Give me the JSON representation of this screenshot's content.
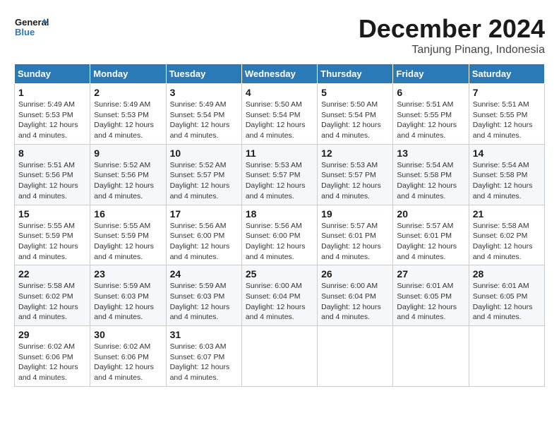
{
  "header": {
    "logo_line1": "General",
    "logo_line2": "Blue",
    "month_title": "December 2024",
    "location": "Tanjung Pinang, Indonesia"
  },
  "days_of_week": [
    "Sunday",
    "Monday",
    "Tuesday",
    "Wednesday",
    "Thursday",
    "Friday",
    "Saturday"
  ],
  "weeks": [
    [
      {
        "day": 1,
        "sunrise": "5:49 AM",
        "sunset": "5:53 PM",
        "daylight": "12 hours and 4 minutes"
      },
      {
        "day": 2,
        "sunrise": "5:49 AM",
        "sunset": "5:53 PM",
        "daylight": "12 hours and 4 minutes"
      },
      {
        "day": 3,
        "sunrise": "5:49 AM",
        "sunset": "5:54 PM",
        "daylight": "12 hours and 4 minutes"
      },
      {
        "day": 4,
        "sunrise": "5:50 AM",
        "sunset": "5:54 PM",
        "daylight": "12 hours and 4 minutes"
      },
      {
        "day": 5,
        "sunrise": "5:50 AM",
        "sunset": "5:54 PM",
        "daylight": "12 hours and 4 minutes"
      },
      {
        "day": 6,
        "sunrise": "5:51 AM",
        "sunset": "5:55 PM",
        "daylight": "12 hours and 4 minutes"
      },
      {
        "day": 7,
        "sunrise": "5:51 AM",
        "sunset": "5:55 PM",
        "daylight": "12 hours and 4 minutes"
      }
    ],
    [
      {
        "day": 8,
        "sunrise": "5:51 AM",
        "sunset": "5:56 PM",
        "daylight": "12 hours and 4 minutes"
      },
      {
        "day": 9,
        "sunrise": "5:52 AM",
        "sunset": "5:56 PM",
        "daylight": "12 hours and 4 minutes"
      },
      {
        "day": 10,
        "sunrise": "5:52 AM",
        "sunset": "5:57 PM",
        "daylight": "12 hours and 4 minutes"
      },
      {
        "day": 11,
        "sunrise": "5:53 AM",
        "sunset": "5:57 PM",
        "daylight": "12 hours and 4 minutes"
      },
      {
        "day": 12,
        "sunrise": "5:53 AM",
        "sunset": "5:57 PM",
        "daylight": "12 hours and 4 minutes"
      },
      {
        "day": 13,
        "sunrise": "5:54 AM",
        "sunset": "5:58 PM",
        "daylight": "12 hours and 4 minutes"
      },
      {
        "day": 14,
        "sunrise": "5:54 AM",
        "sunset": "5:58 PM",
        "daylight": "12 hours and 4 minutes"
      }
    ],
    [
      {
        "day": 15,
        "sunrise": "5:55 AM",
        "sunset": "5:59 PM",
        "daylight": "12 hours and 4 minutes"
      },
      {
        "day": 16,
        "sunrise": "5:55 AM",
        "sunset": "5:59 PM",
        "daylight": "12 hours and 4 minutes"
      },
      {
        "day": 17,
        "sunrise": "5:56 AM",
        "sunset": "6:00 PM",
        "daylight": "12 hours and 4 minutes"
      },
      {
        "day": 18,
        "sunrise": "5:56 AM",
        "sunset": "6:00 PM",
        "daylight": "12 hours and 4 minutes"
      },
      {
        "day": 19,
        "sunrise": "5:57 AM",
        "sunset": "6:01 PM",
        "daylight": "12 hours and 4 minutes"
      },
      {
        "day": 20,
        "sunrise": "5:57 AM",
        "sunset": "6:01 PM",
        "daylight": "12 hours and 4 minutes"
      },
      {
        "day": 21,
        "sunrise": "5:58 AM",
        "sunset": "6:02 PM",
        "daylight": "12 hours and 4 minutes"
      }
    ],
    [
      {
        "day": 22,
        "sunrise": "5:58 AM",
        "sunset": "6:02 PM",
        "daylight": "12 hours and 4 minutes"
      },
      {
        "day": 23,
        "sunrise": "5:59 AM",
        "sunset": "6:03 PM",
        "daylight": "12 hours and 4 minutes"
      },
      {
        "day": 24,
        "sunrise": "5:59 AM",
        "sunset": "6:03 PM",
        "daylight": "12 hours and 4 minutes"
      },
      {
        "day": 25,
        "sunrise": "6:00 AM",
        "sunset": "6:04 PM",
        "daylight": "12 hours and 4 minutes"
      },
      {
        "day": 26,
        "sunrise": "6:00 AM",
        "sunset": "6:04 PM",
        "daylight": "12 hours and 4 minutes"
      },
      {
        "day": 27,
        "sunrise": "6:01 AM",
        "sunset": "6:05 PM",
        "daylight": "12 hours and 4 minutes"
      },
      {
        "day": 28,
        "sunrise": "6:01 AM",
        "sunset": "6:05 PM",
        "daylight": "12 hours and 4 minutes"
      }
    ],
    [
      {
        "day": 29,
        "sunrise": "6:02 AM",
        "sunset": "6:06 PM",
        "daylight": "12 hours and 4 minutes"
      },
      {
        "day": 30,
        "sunrise": "6:02 AM",
        "sunset": "6:06 PM",
        "daylight": "12 hours and 4 minutes"
      },
      {
        "day": 31,
        "sunrise": "6:03 AM",
        "sunset": "6:07 PM",
        "daylight": "12 hours and 4 minutes"
      },
      null,
      null,
      null,
      null
    ]
  ]
}
